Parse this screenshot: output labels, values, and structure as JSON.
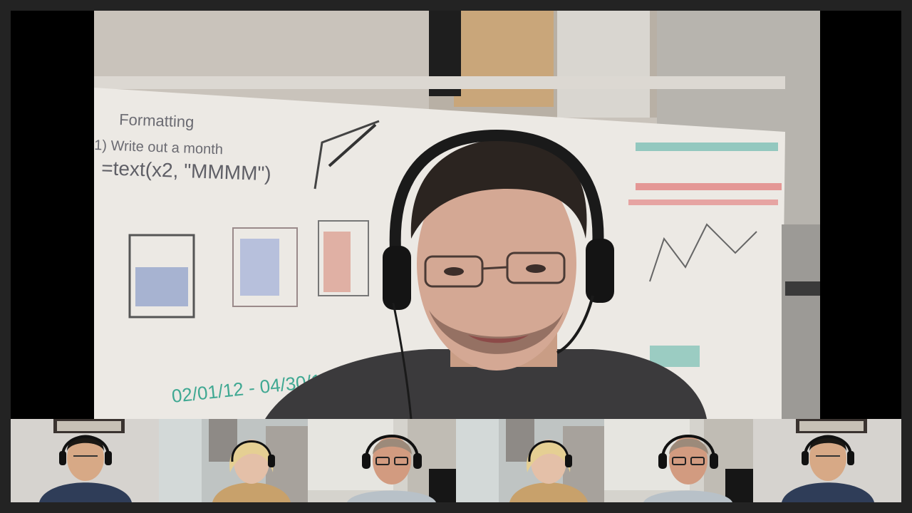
{
  "main_feed": {
    "participant_icon": "user-video-feed",
    "whiteboard_notes": {
      "top_left": "Formatting",
      "line_1": "1) Write out a month",
      "line_2": "=text(x2, \"MMMM\")",
      "date_range": "02/01/12 - 04/30/12"
    }
  },
  "thumbnails": [
    {
      "id": "participant-1",
      "icon": "user-video-feed"
    },
    {
      "id": "participant-2",
      "icon": "user-video-feed"
    },
    {
      "id": "participant-3",
      "icon": "user-video-feed"
    },
    {
      "id": "participant-4",
      "icon": "user-video-feed"
    },
    {
      "id": "participant-5",
      "icon": "user-video-feed"
    },
    {
      "id": "participant-6",
      "icon": "user-video-feed"
    }
  ],
  "colors": {
    "background": "#232323",
    "stage": "#000000",
    "whiteboard": "#ece9e4"
  }
}
